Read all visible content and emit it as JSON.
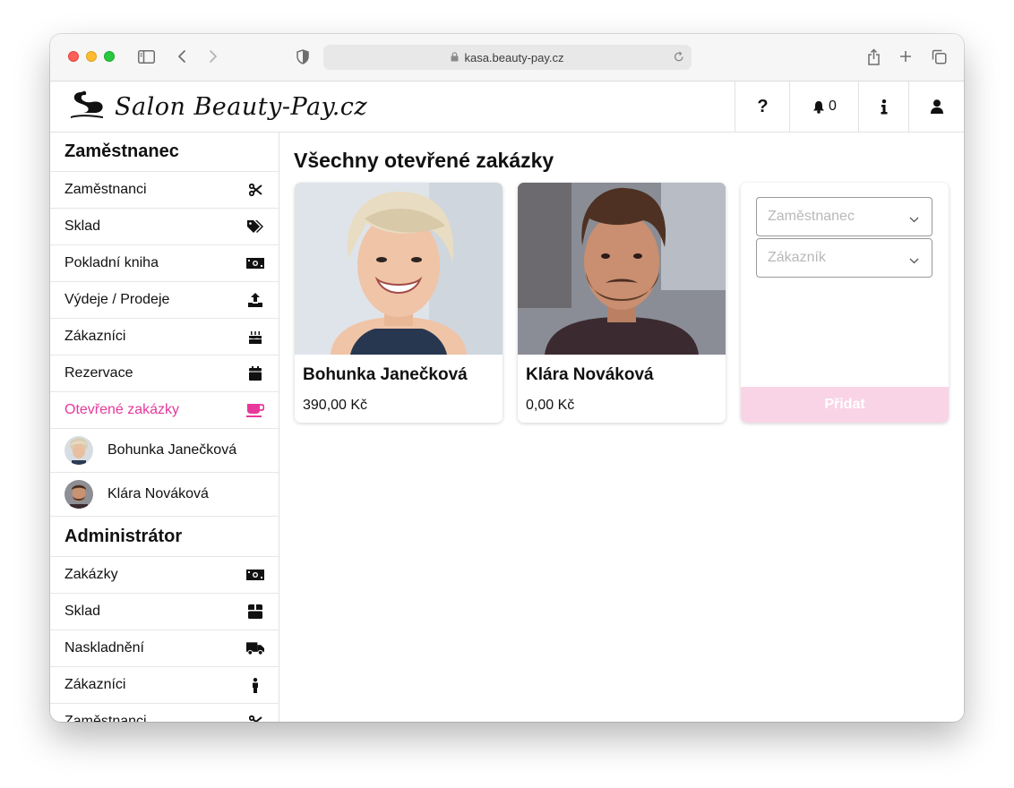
{
  "browser": {
    "url": "kasa.beauty-pay.cz"
  },
  "header": {
    "brand": "Salon  Beauty-Pay.cz",
    "help_label": "?",
    "notifications_count": "0"
  },
  "sidebar": {
    "employee_section": "Zaměstnanec",
    "employee_items": [
      {
        "label": "Zaměstnanci",
        "icon": "scissors-icon"
      },
      {
        "label": "Sklad",
        "icon": "tags-icon"
      },
      {
        "label": "Pokladní kniha",
        "icon": "money-bill-icon"
      },
      {
        "label": "Výdeje / Prodeje",
        "icon": "upload-icon"
      },
      {
        "label": "Zákazníci",
        "icon": "birthday-cake-icon"
      },
      {
        "label": "Rezervace",
        "icon": "calendar-icon"
      },
      {
        "label": "Otevřené zakázky",
        "icon": "coffee-icon",
        "active": true
      }
    ],
    "people": [
      {
        "name": "Bohunka Janečková"
      },
      {
        "name": "Klára Nováková"
      }
    ],
    "admin_section": "Administrátor",
    "admin_items": [
      {
        "label": "Zakázky",
        "icon": "money-bill-icon"
      },
      {
        "label": "Sklad",
        "icon": "box-icon"
      },
      {
        "label": "Naskladnění",
        "icon": "truck-icon"
      },
      {
        "label": "Zákazníci",
        "icon": "person-icon"
      },
      {
        "label": "Zaměstnanci",
        "icon": "scissors-icon"
      }
    ]
  },
  "main": {
    "title": "Všechny otevřené zakázky",
    "cards": [
      {
        "name": "Bohunka Janečková",
        "price": "390,00 Kč"
      },
      {
        "name": "Klára Nováková",
        "price": "0,00 Kč"
      }
    ],
    "form": {
      "employee_placeholder": "Zaměstnanec",
      "customer_placeholder": "Zákazník",
      "add_label": "Přidat"
    }
  },
  "colors": {
    "accent": "#e6399b",
    "button_disabled": "#f9d4e6"
  }
}
